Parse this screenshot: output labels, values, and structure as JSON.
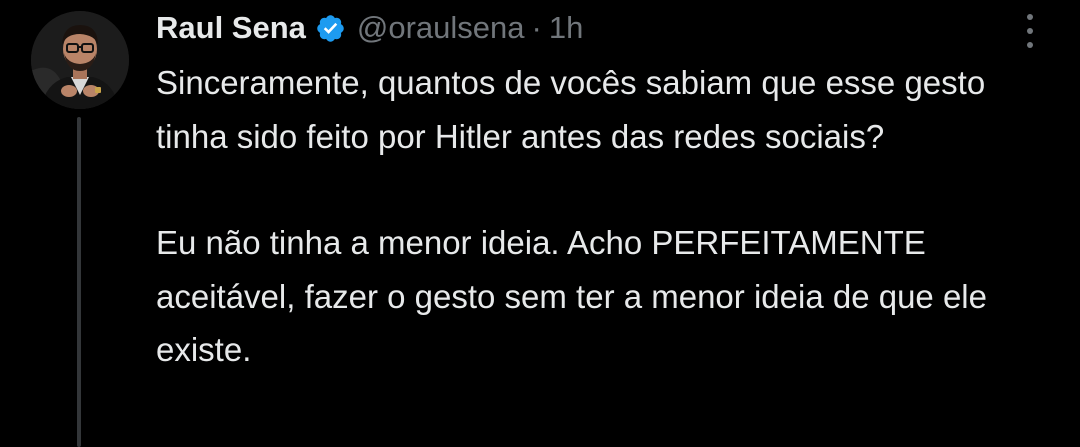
{
  "tweet": {
    "author": {
      "display_name": "Raul Sena",
      "handle": "@oraulsena",
      "verified": true,
      "verified_icon": "verified-badge-icon",
      "avatar_icon": "profile-photo"
    },
    "separator": "·",
    "timestamp": "1h",
    "body": {
      "paragraph_1": "Sinceramente, quantos de vocês sabiam que esse gesto tinha sido feito por Hitler antes das redes sociais?",
      "paragraph_2": "Eu não tinha a menor ideia. Acho PERFEITAMENTE aceitável, fazer o gesto sem ter a menor ideia de que ele existe."
    },
    "more_icon": "more-options-icon"
  },
  "colors": {
    "background": "#000000",
    "text_primary": "#e7e9ea",
    "text_secondary": "#71767b",
    "verified_blue": "#1d9bf0",
    "thread_line": "#333639"
  }
}
